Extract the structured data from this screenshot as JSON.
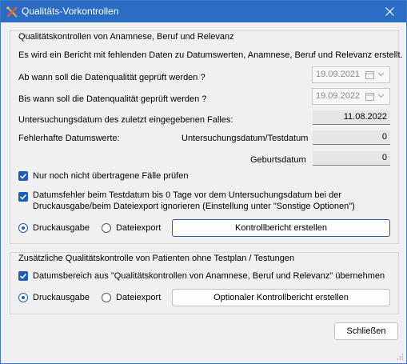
{
  "window": {
    "title": "Qualitäts-Vorkontrollen"
  },
  "group1": {
    "title": "Qualitätskontrollen von Anamnese, Beruf und Relevanz",
    "description": "Es wird ein Bericht mit fehlenden Daten zu Datumswerten, Anamnese, Beruf und Relevanz erstellt.",
    "from_label": "Ab wann soll die Datenqualität geprüft werden ?",
    "from_date": "19.09.2021",
    "to_label": "Bis wann soll die Datenqualität geprüft werden ?",
    "to_date": "19.09.2022",
    "last_exam_label": "Untersuchungsdatum des zuletzt eingegebenen Falles:",
    "last_exam_value": "11.08.2022",
    "faulty_label": "Fehlerhafte Datumswerte:",
    "exam_test_label": "Untersuchungsdatum/Testdatum",
    "exam_test_value": "0",
    "birth_label": "Geburtsdatum",
    "birth_value": "0",
    "check1_label": "Nur noch nicht übertragene Fälle prüfen",
    "check1_checked": true,
    "check2_line1": "Datumsfehler beim Testdatum bis 0 Tage vor dem Untersuchungsdatum bei der",
    "check2_line2": "Druckausgabe/beim Dateiexport ignorieren (Einstellung unter \"Sonstige Optionen\")",
    "check2_checked": true,
    "radio_print": "Druckausgabe",
    "radio_export": "Dateiexport",
    "selected_output": "Druckausgabe",
    "button": "Kontrollbericht erstellen"
  },
  "group2": {
    "title": "Zusätzliche Qualitätskontrolle von Patienten ohne Testplan / Testungen",
    "check_label": "Datumsbereich aus \"Qualitätskontrollen von Anamnese, Beruf und Relevanz\" übernehmen",
    "check_checked": true,
    "radio_print": "Druckausgabe",
    "radio_export": "Dateiexport",
    "selected_output": "Druckausgabe",
    "button": "Optionaler Kontrollbericht erstellen"
  },
  "footer": {
    "close_button": "Schließen"
  },
  "colors": {
    "titlebar": "#2b6cc4",
    "accent": "#1f5db8",
    "background": "#f0f0f0"
  },
  "icons": {
    "app": "tools-icon",
    "close": "close-icon",
    "calendar": "calendar-icon",
    "dropdown": "chevron-down-icon",
    "grip": "resize-grip-icon"
  }
}
